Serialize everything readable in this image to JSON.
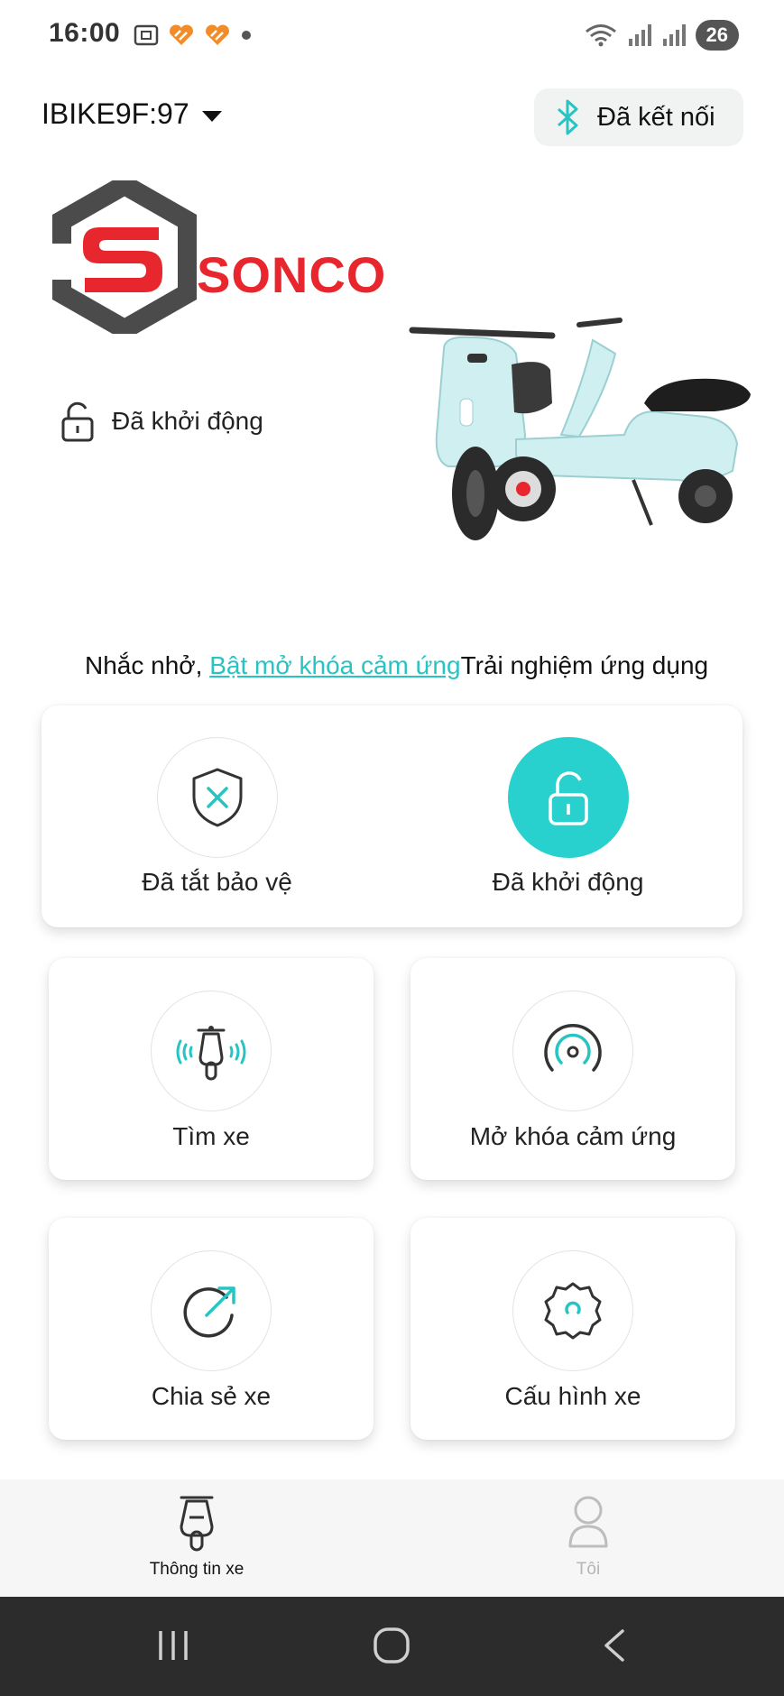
{
  "status_bar": {
    "time": "16:00",
    "battery": "26",
    "icons_left": [
      "screenshot-icon",
      "app-notification-icon",
      "app-notification-icon",
      "dot-icon"
    ],
    "icons_right": [
      "wifi-icon",
      "signal-icon",
      "signal-icon",
      "battery-icon"
    ]
  },
  "header": {
    "device_name": "IBIKE9F:97",
    "connection_status": "Đã kết nối"
  },
  "brand": {
    "name": "SONCO",
    "logo_letter": "S",
    "color": "#e8262d"
  },
  "vehicle_status": {
    "label": "Đã khởi động"
  },
  "reminder": {
    "prefix": "Nhắc nhở,",
    "link": "Bật mở khóa cảm ứng",
    "suffix": "Trải nghiệm ứng dụng"
  },
  "controls": {
    "protection": {
      "label": "Đã tắt bảo vệ",
      "icon": "shield-x-icon"
    },
    "ignition": {
      "label": "Đã khởi động",
      "icon": "unlock-icon"
    }
  },
  "features": [
    {
      "label": "Tìm xe",
      "icon": "find-bike-icon"
    },
    {
      "label": "Mở khóa cảm ứng",
      "icon": "proximity-unlock-icon"
    },
    {
      "label": "Chia sẻ xe",
      "icon": "share-arrow-icon"
    },
    {
      "label": "Cấu hình xe",
      "icon": "settings-gear-icon"
    }
  ],
  "tabs": [
    {
      "label": "Thông tin xe",
      "icon": "scooter-icon",
      "active": true
    },
    {
      "label": "Tôi",
      "icon": "person-icon",
      "active": false
    }
  ],
  "colors": {
    "accent": "#28d1cd",
    "brand_red": "#e8262d",
    "tabbar_bg": "#f6f6f6",
    "sysnav_bg": "#2c2c2c"
  }
}
